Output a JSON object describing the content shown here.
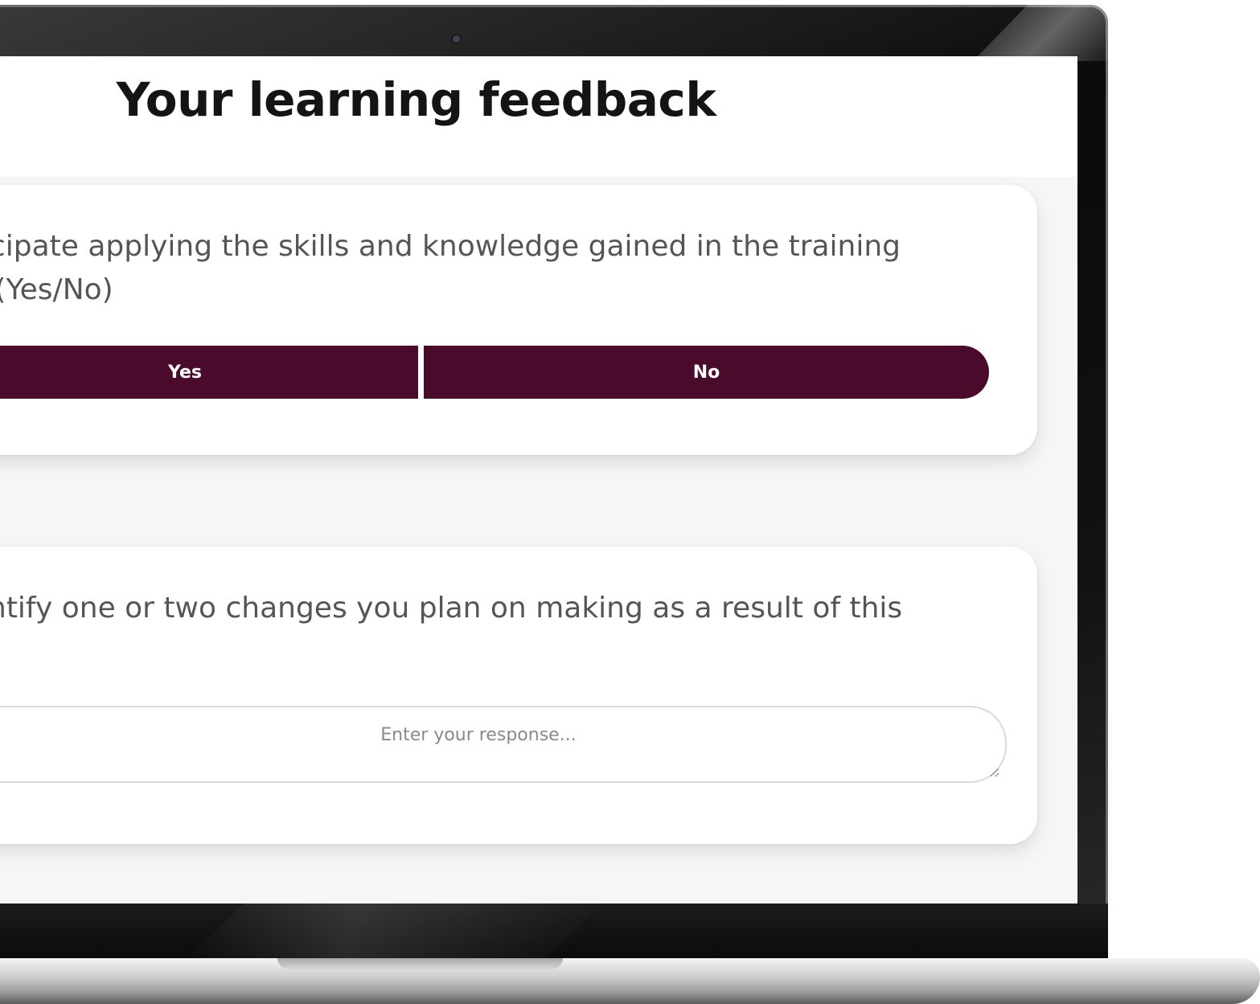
{
  "page": {
    "title": "Your learning feedback"
  },
  "question1": {
    "line1": "nticipate applying the skills and knowledge gained in the training",
    "line2": "b? (Yes/No)",
    "options": [
      "Yes",
      "No"
    ]
  },
  "question2": {
    "line1": "dentify one or two changes you plan on making as a result of this",
    "placeholder": "Enter your response..."
  },
  "colors": {
    "accent": "#4a0a2b",
    "title_text": "#141414",
    "question_text": "#555555"
  },
  "icons": {
    "resize": "resize-grip-icon",
    "camera": "webcam-icon"
  }
}
